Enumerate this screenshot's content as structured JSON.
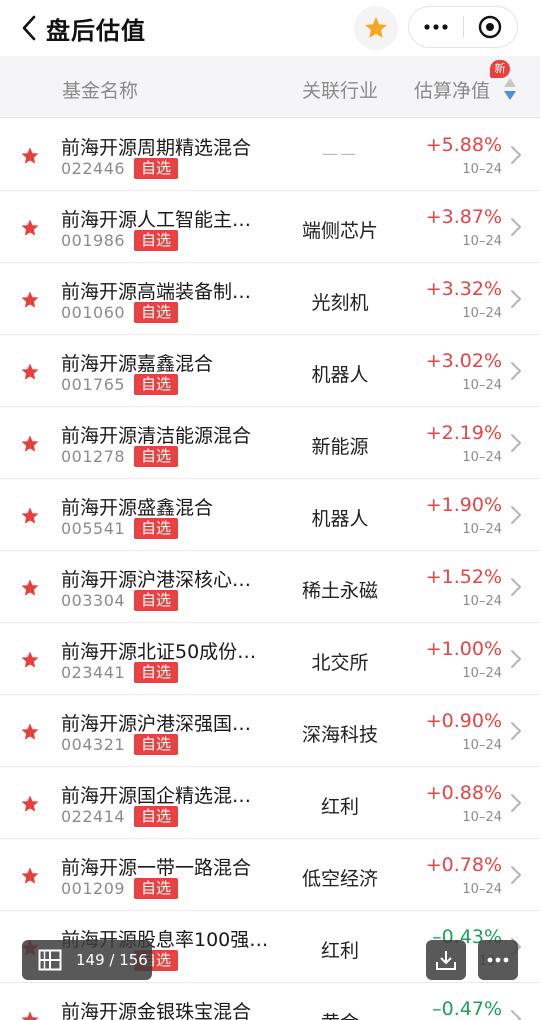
{
  "nav": {
    "title": "盘后估值"
  },
  "header": {
    "col_name": "基金名称",
    "col_industry": "关联行业",
    "col_nav": "估算净值",
    "new_badge": "新"
  },
  "colors": {
    "up": "#e54545",
    "down": "#1da15a",
    "star": "#e8403f",
    "favorite": "#f5a623"
  },
  "rows": [
    {
      "name": "前海开源周期精选混合",
      "code": "022446",
      "tag": "自选",
      "industry": "——",
      "change": "+5.88%",
      "date": "10–24",
      "trend": "up"
    },
    {
      "name": "前海开源人工智能主…",
      "code": "001986",
      "tag": "自选",
      "industry": "端侧芯片",
      "change": "+3.87%",
      "date": "10–24",
      "trend": "up"
    },
    {
      "name": "前海开源高端装备制…",
      "code": "001060",
      "tag": "自选",
      "industry": "光刻机",
      "change": "+3.32%",
      "date": "10–24",
      "trend": "up"
    },
    {
      "name": "前海开源嘉鑫混合",
      "code": "001765",
      "tag": "自选",
      "industry": "机器人",
      "change": "+3.02%",
      "date": "10–24",
      "trend": "up"
    },
    {
      "name": "前海开源清洁能源混合",
      "code": "001278",
      "tag": "自选",
      "industry": "新能源",
      "change": "+2.19%",
      "date": "10–24",
      "trend": "up"
    },
    {
      "name": "前海开源盛鑫混合",
      "code": "005541",
      "tag": "自选",
      "industry": "机器人",
      "change": "+1.90%",
      "date": "10–24",
      "trend": "up"
    },
    {
      "name": "前海开源沪港深核心…",
      "code": "003304",
      "tag": "自选",
      "industry": "稀土永磁",
      "change": "+1.52%",
      "date": "10–24",
      "trend": "up"
    },
    {
      "name": "前海开源北证50成份…",
      "code": "023441",
      "tag": "自选",
      "industry": "北交所",
      "change": "+1.00%",
      "date": "10–24",
      "trend": "up"
    },
    {
      "name": "前海开源沪港深强国…",
      "code": "004321",
      "tag": "自选",
      "industry": "深海科技",
      "change": "+0.90%",
      "date": "10–24",
      "trend": "up"
    },
    {
      "name": "前海开源国企精选混…",
      "code": "022414",
      "tag": "自选",
      "industry": "红利",
      "change": "+0.88%",
      "date": "10–24",
      "trend": "up"
    },
    {
      "name": "前海开源一带一路混合",
      "code": "001209",
      "tag": "自选",
      "industry": "低空经济",
      "change": "+0.78%",
      "date": "10–24",
      "trend": "up"
    },
    {
      "name": "前海开源股息率100强…",
      "code": "",
      "tag": "自选",
      "industry": "红利",
      "change": "–0.43%",
      "date": "10–",
      "trend": "down"
    },
    {
      "name": "前海开源金银珠宝混合",
      "code": "",
      "tag": "",
      "industry": "黄金",
      "change": "–0.47%",
      "date": "",
      "trend": "down"
    }
  ],
  "pager": {
    "text": "149 / 156"
  }
}
